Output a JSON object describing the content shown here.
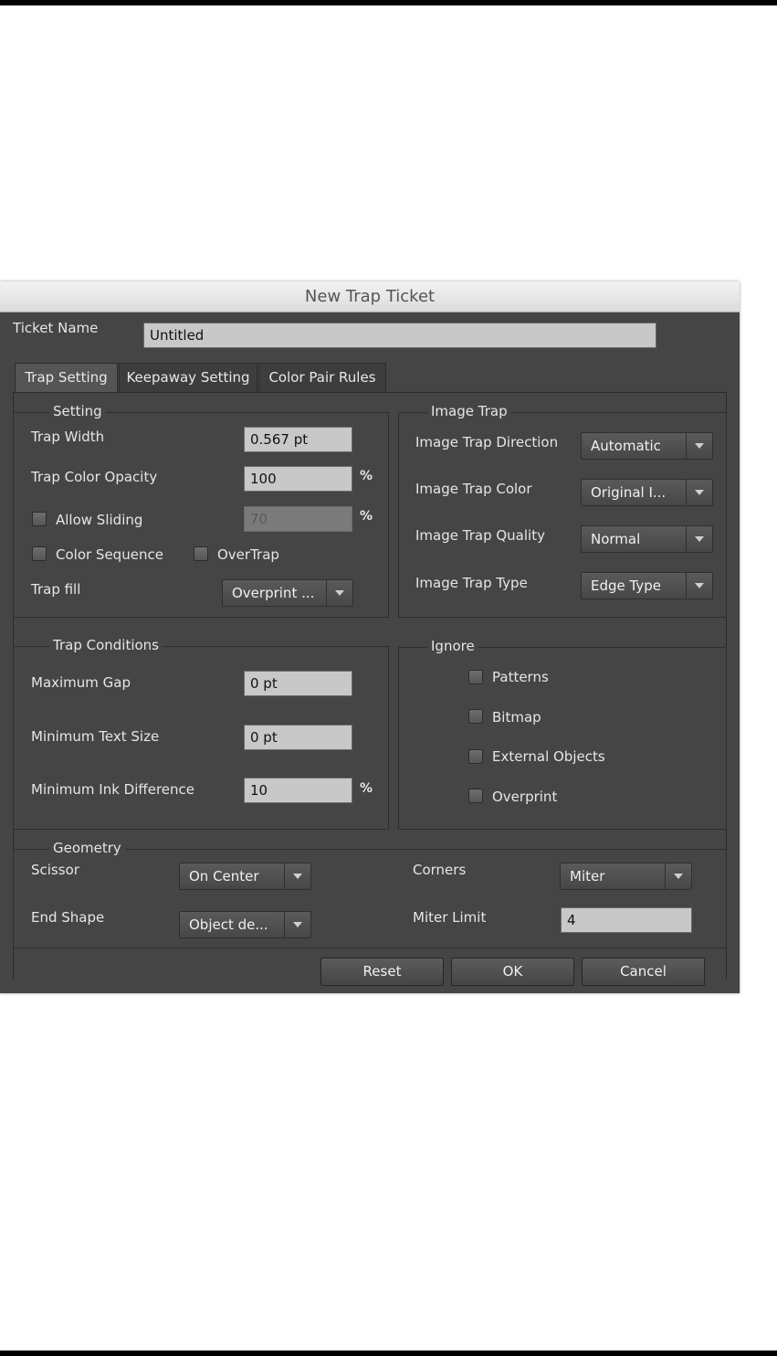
{
  "window": {
    "title": "New Trap Ticket"
  },
  "ticket": {
    "label": "Ticket Name",
    "value": "Untitled"
  },
  "tabs": [
    {
      "label": "Trap Setting"
    },
    {
      "label": "Keepaway Setting"
    },
    {
      "label": "Color Pair Rules"
    }
  ],
  "setting": {
    "legend": "Setting",
    "trap_width_label": "Trap Width",
    "trap_width_value": "0.567 pt",
    "opacity_label": "Trap Color Opacity",
    "opacity_value": "100",
    "opacity_unit": "%",
    "allow_sliding_label": "Allow Sliding",
    "sliding_value": "70",
    "sliding_unit": "%",
    "color_sequence_label": "Color Sequence",
    "overtrap_label": "OverTrap",
    "trap_fill_label": "Trap fill",
    "trap_fill_value": "Overprint ..."
  },
  "image_trap": {
    "legend": "Image Trap",
    "direction_label": "Image Trap Direction",
    "direction_value": "Automatic",
    "color_label": "Image Trap Color",
    "color_value": "Original I...",
    "quality_label": "Image Trap Quality",
    "quality_value": "Normal",
    "type_label": "Image Trap Type",
    "type_value": "Edge Type"
  },
  "trap_conditions": {
    "legend": "Trap Conditions",
    "max_gap_label": "Maximum Gap",
    "max_gap_value": "0 pt",
    "min_text_label": "Minimum Text Size",
    "min_text_value": "0 pt",
    "min_ink_label": "Minimum Ink Difference",
    "min_ink_value": "10",
    "min_ink_unit": "%"
  },
  "ignore": {
    "legend": "Ignore",
    "patterns_label": "Patterns",
    "bitmap_label": "Bitmap",
    "external_label": "External Objects",
    "overprint_label": "Overprint"
  },
  "geometry": {
    "legend": "Geometry",
    "scissor_label": "Scissor",
    "scissor_value": "On Center",
    "end_shape_label": "End Shape",
    "end_shape_value": "Object de...",
    "corners_label": "Corners",
    "corners_value": "Miter",
    "miter_limit_label": "Miter Limit",
    "miter_limit_value": "4"
  },
  "buttons": {
    "reset": "Reset",
    "ok": "OK",
    "cancel": "Cancel"
  }
}
